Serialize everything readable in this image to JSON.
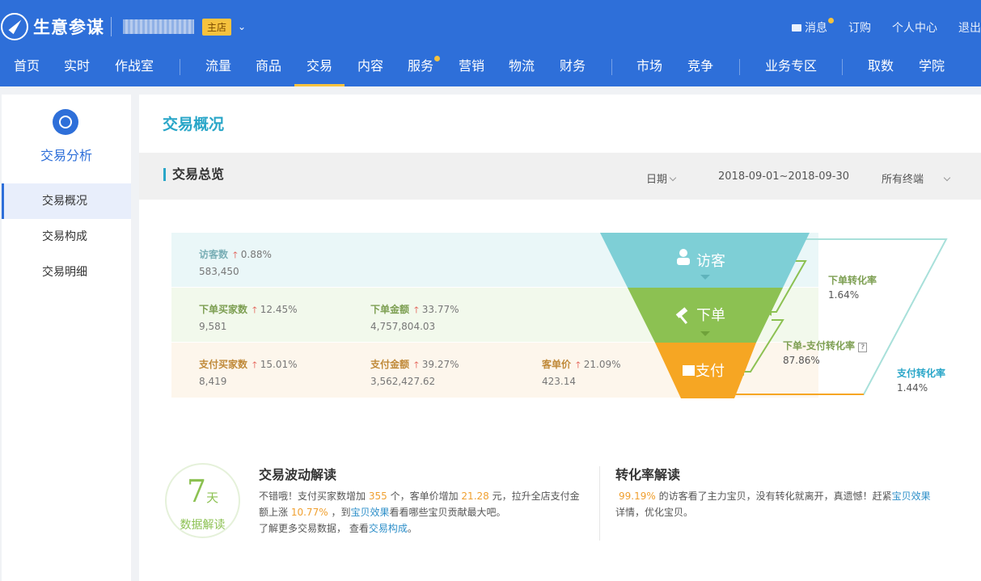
{
  "header": {
    "app_title": "生意参谋",
    "shop_badge": "主店",
    "top_links": {
      "message": "消息",
      "order": "订购",
      "personal": "个人中心",
      "logout": "退出"
    },
    "nav": [
      "首页",
      "实时",
      "作战室",
      "流量",
      "商品",
      "交易",
      "内容",
      "服务",
      "营销",
      "物流",
      "财务",
      "市场",
      "竞争",
      "业务专区",
      "取数",
      "学院"
    ],
    "active_nav": "交易"
  },
  "sidebar": {
    "title": "交易分析",
    "items": [
      "交易概况",
      "交易构成",
      "交易明细"
    ],
    "active": "交易概况"
  },
  "main": {
    "page_title": "交易概况",
    "section_title": "交易总览",
    "filters": {
      "date_label": "日期",
      "date_range": "2018-09-01~2018-09-30",
      "terminal": "所有终端"
    }
  },
  "funnel": {
    "stages": {
      "visitor": "访客",
      "order": "下单",
      "pay": "支付"
    },
    "visitors": {
      "label": "访客数",
      "change": "0.88%",
      "value": "583,450"
    },
    "order_buyers": {
      "label": "下单买家数",
      "change": "12.45%",
      "value": "9,581"
    },
    "order_amount": {
      "label": "下单金额",
      "change": "33.77%",
      "value": "4,757,804.03"
    },
    "pay_buyers": {
      "label": "支付买家数",
      "change": "15.01%",
      "value": "8,419"
    },
    "pay_amount": {
      "label": "支付金额",
      "change": "39.27%",
      "value": "3,562,427.62"
    },
    "avg_price": {
      "label": "客单价",
      "change": "21.09%",
      "value": "423.14"
    },
    "rates": {
      "order_rate": {
        "label": "下单转化率",
        "value": "1.64%"
      },
      "order_pay_rate": {
        "label": "下单-支付转化率",
        "value": "87.86%"
      },
      "pay_rate": {
        "label": "支付转化率",
        "value": "1.44%"
      }
    },
    "colors": {
      "visitor": "#7ecfd6",
      "order": "#8cc152",
      "pay": "#f6a623"
    }
  },
  "insights": {
    "badge_num": "7",
    "badge_unit": "天",
    "badge_sub": "数据解读",
    "trade": {
      "title": "交易波动解读",
      "t1": "不错哦！支付买家数增加",
      "n1": "355",
      "t2": "个，客单价增加",
      "n2": "21.28",
      "t3": "元，拉升全店支付金额上涨",
      "n3": "10.77%",
      "t4": "，到",
      "link1": "宝贝效果",
      "t5": "看看哪些宝贝贡献最大吧。",
      "t6": "了解更多交易数据，  查看",
      "link2": "交易构成",
      "t7": "。"
    },
    "conversion": {
      "title": "转化率解读",
      "n1": "99.19%",
      "t1": "的访客看了主力宝贝，没有转化就离开，真遗憾！赶紧",
      "link1": "宝贝效果",
      "t2": "详情，优化宝贝。"
    }
  }
}
